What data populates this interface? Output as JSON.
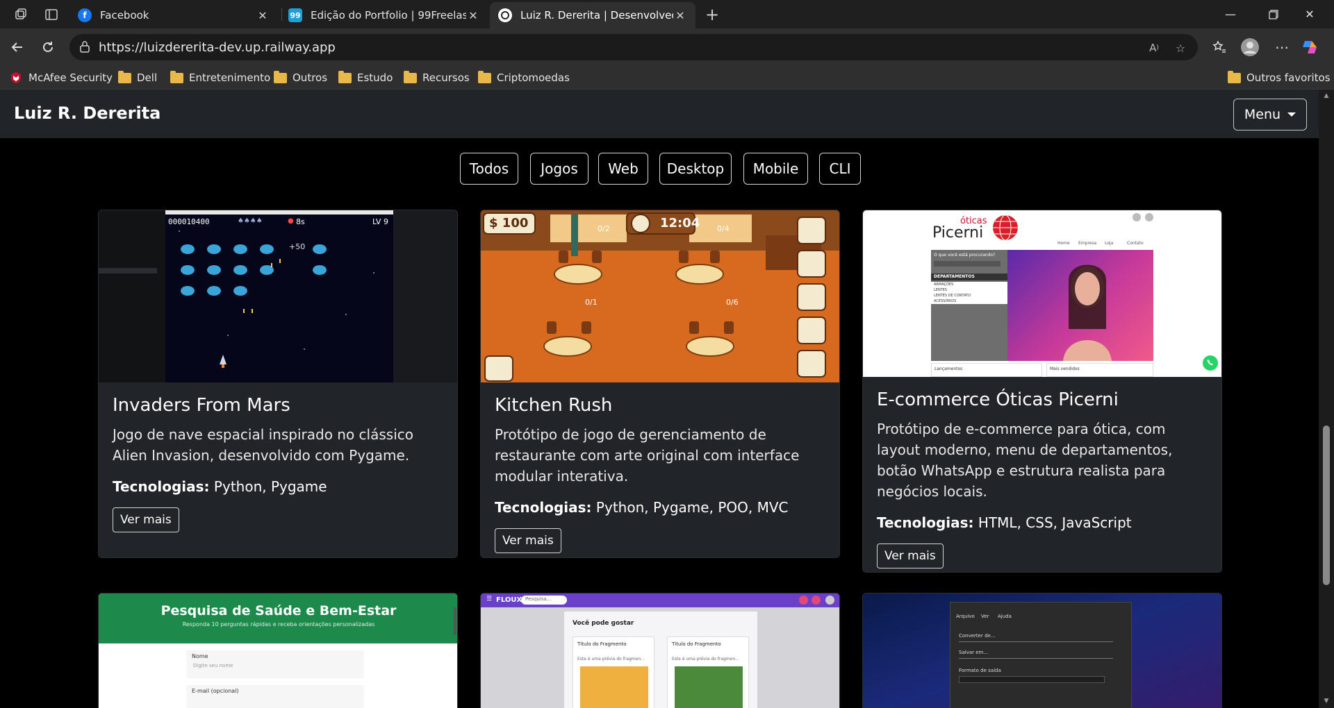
{
  "browser": {
    "tabs": [
      {
        "title": "Facebook",
        "favicon": "facebook-icon",
        "active": false
      },
      {
        "title": "Edição do Portfolio | 99Freelas",
        "favicon": "99freelas-icon",
        "active": false
      },
      {
        "title": "Luiz R. Dererita | Desenvolvedor F",
        "favicon": "site-icon",
        "active": true
      }
    ],
    "url": "https://luizdererita-dev.up.railway.app",
    "bookmarks": [
      "McAfee Security",
      "Dell",
      "Entretenimento",
      "Outros",
      "Estudo",
      "Recursos",
      "Criptomoedas"
    ],
    "other_favorites": "Outros favoritos"
  },
  "site": {
    "brand": "Luiz R. Dererita",
    "menu_label": "Menu",
    "filters": [
      "Todos",
      "Jogos",
      "Web",
      "Desktop",
      "Mobile",
      "CLI"
    ],
    "tech_label": "Tecnologias:",
    "projects": [
      {
        "title": "Invaders From Mars",
        "description": "Jogo de nave espacial inspirado no clássico Alien Invasion, desenvolvido com Pygame.",
        "technologies": "Python, Pygame",
        "button": "Ver mais",
        "screenshot_text": {
          "score": "000010400",
          "time": "8s",
          "level": "LV 9",
          "bonus": "+50"
        }
      },
      {
        "title": "Kitchen Rush",
        "description": "Protótipo de jogo de gerenciamento de restaurante com arte original com interface modular interativa.",
        "technologies": "Python, Pygame, POO, MVC",
        "button": "Ver mais",
        "screenshot_text": {
          "money": "$ 100",
          "clock": "12:04",
          "counters": [
            "0/2",
            "0/4",
            "0/1",
            "0/6"
          ]
        }
      },
      {
        "title": "E-commerce Óticas Picerni",
        "description": "Protótipo de e-commerce para ótica, com layout moderno, menu de departamentos, botão WhatsApp e estrutura realista para negócios locais.",
        "technologies": "HTML, CSS, JavaScript",
        "button": "Ver mais",
        "screenshot_text": {
          "logo_small": "óticas",
          "logo_big": "Picerni",
          "nav": [
            "Home",
            "Empresa",
            "Loja",
            "Contato"
          ],
          "search": "O que você está procurando?",
          "departments": "DEPARTAMENTOS",
          "dept_items": [
            "ARMAÇÕES",
            "LENTES",
            "LENTES DE CONTATO",
            "ACESSÓRIOS"
          ],
          "bottom": [
            "Lançamentos",
            "Mais vendidos"
          ]
        }
      }
    ],
    "preview_cards": [
      {
        "heading": "Pesquisa de Saúde e Bem-Estar",
        "subheading": "Responda 10 perguntas rápidas e receba orientações personalizadas",
        "fields": [
          "Nome",
          "E-mail (opcional)"
        ],
        "placeholder": "Digite seu nome"
      },
      {
        "app": "FLOUX",
        "search": "Pesquisa...",
        "heading": "Você pode gostar",
        "cards": [
          "Título do Fragmento",
          "Título do Fragmento"
        ],
        "snippet": "Este é uma prévia do fragmen..."
      },
      {
        "menu": [
          "Arquivo",
          "Ver",
          "Ajuda"
        ],
        "fields": [
          "Converter de...",
          "Salvar em...",
          "Formato de saída"
        ]
      }
    ]
  }
}
